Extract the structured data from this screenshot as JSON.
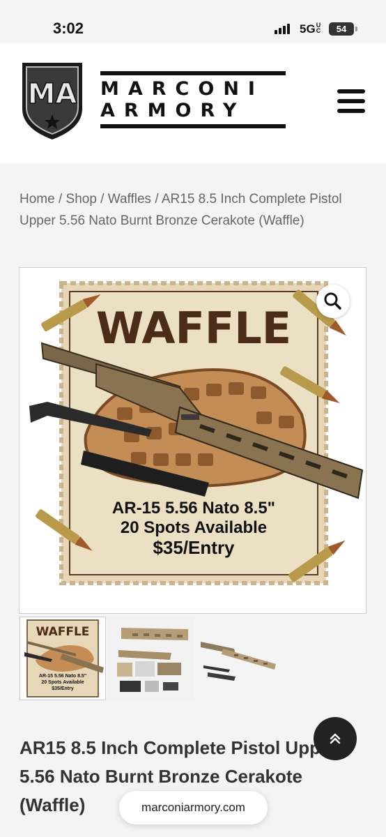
{
  "status_bar": {
    "time": "3:02",
    "network": "5G",
    "network_sub": "UC",
    "battery": "54"
  },
  "header": {
    "logo_letters": "MA",
    "brand_line1": "MARCONI",
    "brand_line2": "ARMORY",
    "menu_icon": "hamburger-icon"
  },
  "breadcrumb": {
    "home": "Home",
    "shop": "Shop",
    "category": "Waffles",
    "separator": " / ",
    "current": "AR15 8.5 Inch Complete Pistol Upper 5.56 Nato Burnt Bronze Cerakote (Waffle)"
  },
  "product_image": {
    "headline": "WAFFLE",
    "line1": "AR-15 5.56 Nato 8.5\"",
    "line2": "20 Spots Available",
    "line3": "$35/Entry",
    "zoom_icon": "magnifier-icon"
  },
  "thumbnails": {
    "thumb1_headline": "WAFFLE",
    "thumb1_line1": "AR-15 5.56 Nato 8.5\"",
    "thumb1_line2": "20 Spots Available",
    "thumb1_line3": "$35/Entry"
  },
  "product": {
    "title": "AR15 8.5 Inch Complete Pistol Upper 5.56 Nato Burnt Bronze Cerakote (Waffle)"
  },
  "browser": {
    "url": "marconiarmory.com"
  },
  "colors": {
    "accent_dark": "#111111",
    "bronze": "#8a7350",
    "paper": "#e6d7b8",
    "waffle": "#c48d55"
  }
}
